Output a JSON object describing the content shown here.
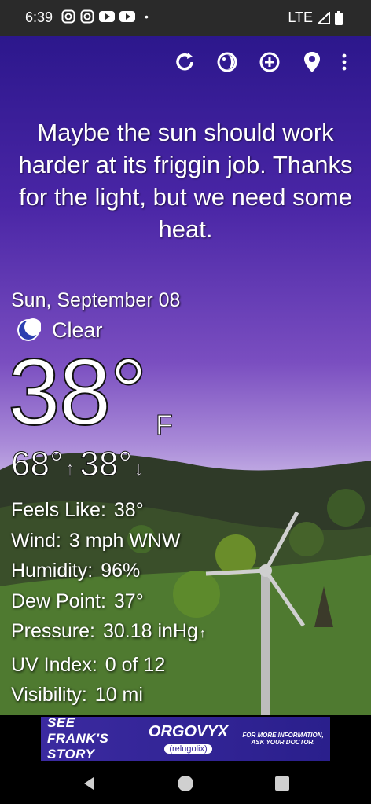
{
  "status_bar": {
    "time": "6:39",
    "network": "LTE",
    "notification_icons": [
      "instagram-icon",
      "instagram-icon",
      "youtube-icon",
      "youtube-icon"
    ]
  },
  "toolbar": {
    "icons": [
      "refresh-icon",
      "theme-icon",
      "add-location-icon",
      "location-pin-icon",
      "more-vert-icon"
    ]
  },
  "weather": {
    "quote": "Maybe the sun should work harder at its friggin job. Thanks for the light, but we need some heat.",
    "date": "Sun, September 08",
    "condition": "Clear",
    "condition_icon": "crescent-moon-icon",
    "temperature": "38°",
    "unit": "F",
    "high": "68°",
    "low": "38°",
    "details": [
      {
        "label": "Feels Like:",
        "value": "38°"
      },
      {
        "label": "Wind:",
        "value": "3 mph WNW"
      },
      {
        "label": "Humidity:",
        "value": "96%"
      },
      {
        "label": "Dew Point:",
        "value": "37°"
      },
      {
        "label": "Pressure:",
        "value": "30.18 inHg",
        "trend": "↑"
      },
      {
        "label": "UV Index:",
        "value": "0 of 12"
      },
      {
        "label": "Visibility:",
        "value": "10 mi"
      }
    ]
  },
  "ad": {
    "left_text": "SEE FRANK'S STORY",
    "brand": "ORGOVYX",
    "brand_sub": "(relugolix)",
    "right_text": "FOR MORE INFORMATION, ASK YOUR DOCTOR."
  },
  "colors": {
    "sky_top": "#2c178c",
    "sky_bottom": "#c7b4e6",
    "hill_dark": "#2f3a28",
    "hill_green": "#4f7a30"
  }
}
